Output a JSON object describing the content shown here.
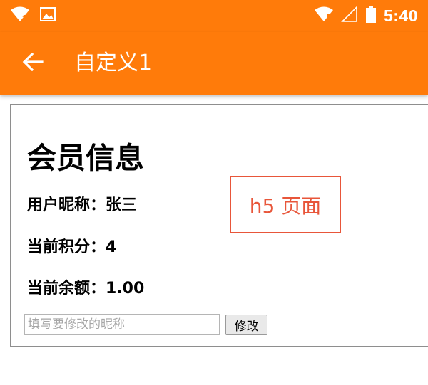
{
  "status_bar": {
    "time": "5:40",
    "icons": [
      "wifi-question-icon",
      "image-icon",
      "wifi-alert-icon",
      "cell-signal-icon",
      "battery-icon"
    ]
  },
  "app_bar": {
    "title": "自定义1",
    "back_icon": "arrow-left-icon",
    "color": "#ff7b0a"
  },
  "page": {
    "title": "会员信息",
    "nickname_label": "用户昵称：",
    "nickname_value": "张三",
    "points_label": "当前积分：",
    "points_value": "4",
    "balance_label": "当前余额：",
    "balance_value": "1.00",
    "nickname_input": {
      "placeholder": "填写要修改的昵称",
      "value": ""
    },
    "modify_button_label": "修改"
  },
  "annotation": {
    "text": "h5 页面",
    "color": "#e8563a"
  }
}
